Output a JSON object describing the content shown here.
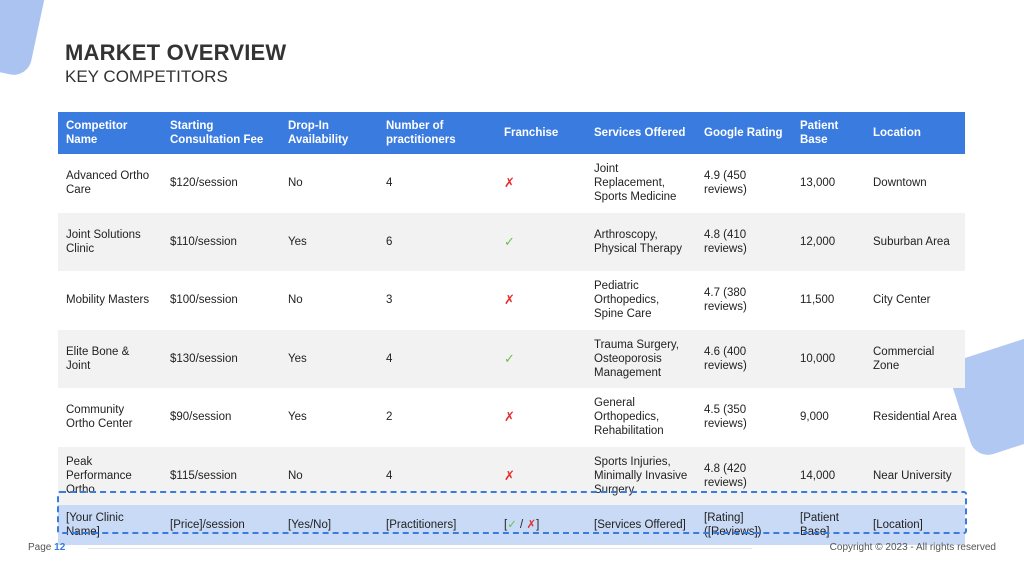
{
  "header": {
    "title": "MARKET OVERVIEW",
    "subtitle": "KEY COMPETITORS"
  },
  "table": {
    "columns": [
      "Competitor Name",
      "Starting Consultation Fee",
      "Drop-In Availability",
      "Number of practitioners",
      "Franchise",
      "Services Offered",
      "Google Rating",
      "Patient Base",
      "Location"
    ],
    "rows": [
      [
        "Advanced Ortho Care",
        "$120/session",
        "No",
        "4",
        "✗",
        "Joint Replacement, Sports Medicine",
        "4.9 (450 reviews)",
        "13,000",
        "Downtown"
      ],
      [
        "Joint Solutions Clinic",
        "$110/session",
        "Yes",
        "6",
        "✓",
        "Arthroscopy, Physical Therapy",
        "4.8 (410 reviews)",
        "12,000",
        "Suburban Area"
      ],
      [
        "Mobility Masters",
        "$100/session",
        "No",
        "3",
        "✗",
        "Pediatric Orthopedics, Spine Care",
        "4.7 (380 reviews)",
        "11,500",
        "City Center"
      ],
      [
        "Elite Bone & Joint",
        "$130/session",
        "Yes",
        "4",
        "✓",
        "Trauma Surgery, Osteoporosis Management",
        "4.6 (400 reviews)",
        "10,000",
        "Commercial Zone"
      ],
      [
        "Community Ortho Center",
        "$90/session",
        "Yes",
        "2",
        "✗",
        "General Orthopedics, Rehabilitation",
        "4.5 (350 reviews)",
        "9,000",
        "Residential Area"
      ],
      [
        "Peak Performance Ortho",
        "$115/session",
        "No",
        "4",
        "✗",
        "Sports Injuries, Minimally Invasive Surgery",
        "4.8 (420 reviews)",
        "14,000",
        "Near University"
      ]
    ],
    "your_clinic": {
      "name": "[Your Clinic Name]",
      "price": "[Price]/session",
      "drop_in": "[Yes/No]",
      "practitioners": "[Practitioners]",
      "franchise_open": "[",
      "franchise_check": "✓",
      "franchise_sep": " / ",
      "franchise_cross": "✗",
      "franchise_close": "]",
      "services": "[Services Offered]",
      "rating": "[Rating] ([Reviews])",
      "patient_base": "[Patient Base]",
      "location": "[Location]"
    }
  },
  "footer": {
    "page_label": "Page",
    "page_number": "12",
    "copyright": "Copyright © 2023 - All rights reserved"
  },
  "colors": {
    "header_bg": "#3a7be0",
    "highlight_row": "#c9daf6",
    "cross": "#e03030",
    "check": "#6cc04a"
  }
}
